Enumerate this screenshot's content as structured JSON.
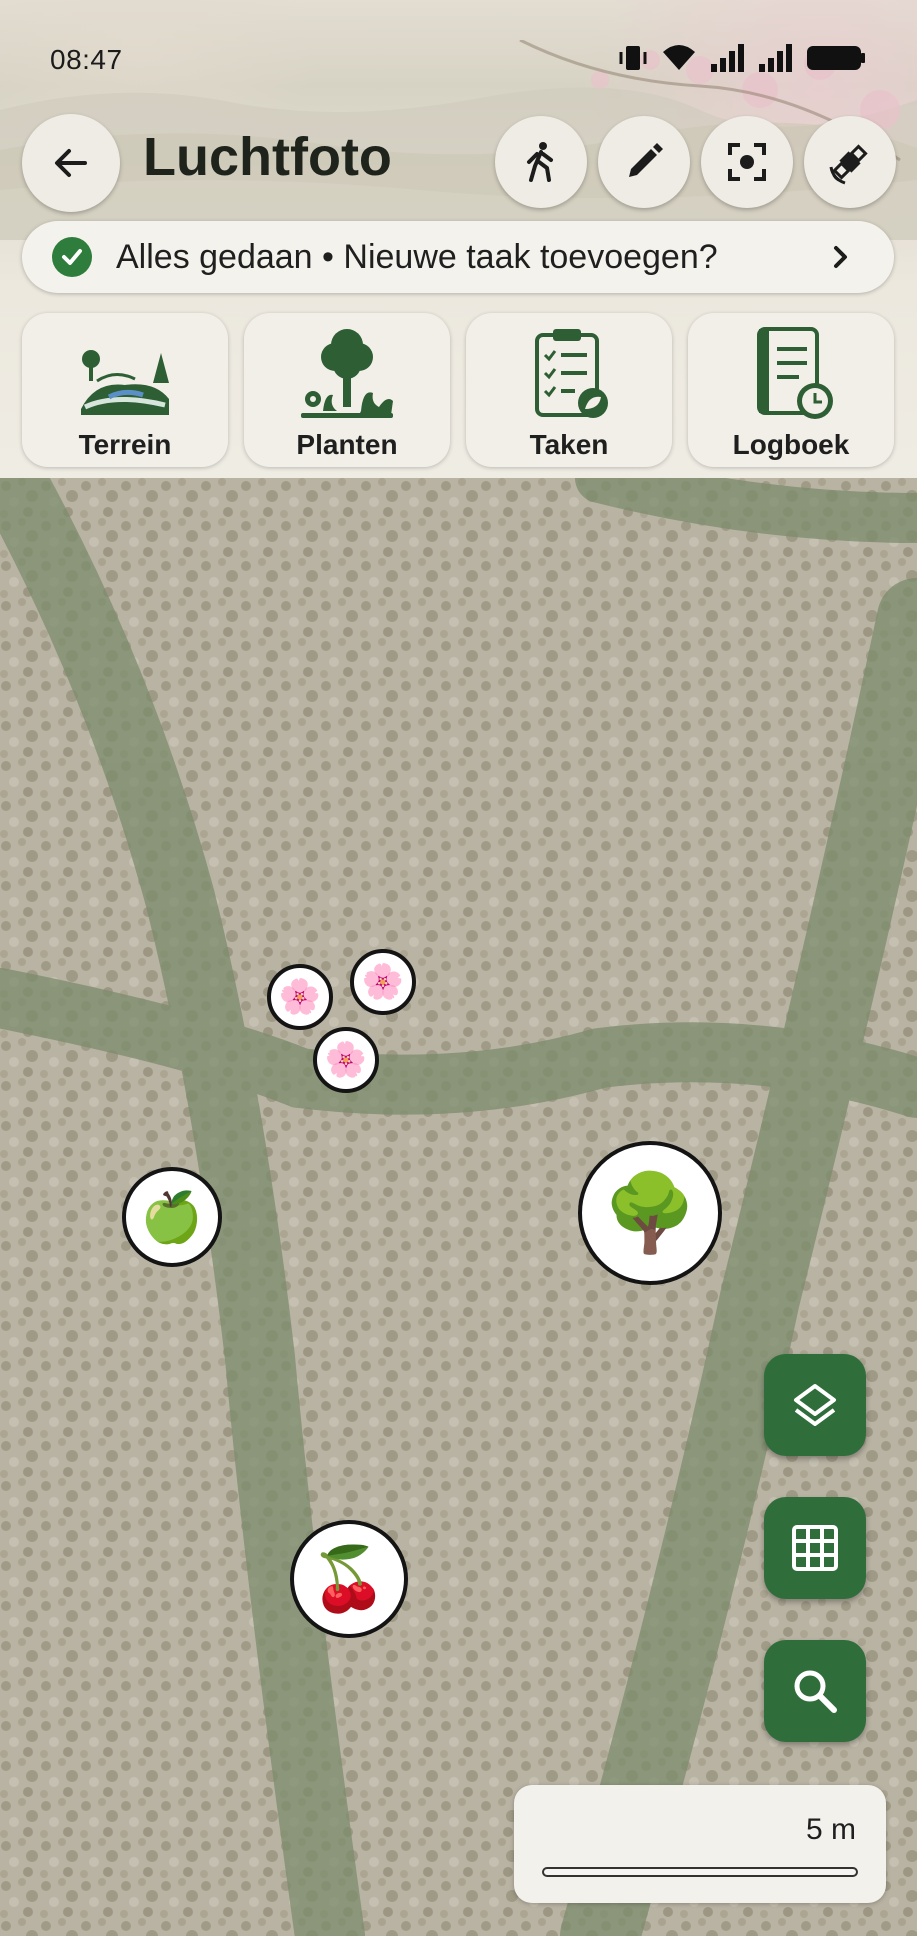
{
  "status_bar": {
    "time": "08:47",
    "icons": [
      "vibrate-icon",
      "wifi-icon",
      "signal-icon",
      "signal-icon",
      "battery-icon"
    ]
  },
  "header": {
    "title": "Luchtfoto",
    "back_icon": "arrow-left-icon",
    "actions": [
      "walk-icon",
      "pencil-icon",
      "center-focus-icon",
      "satellite-icon"
    ]
  },
  "banner": {
    "text": "Alles gedaan • Nieuwe taak toevoegen?",
    "icon": "check-circle-icon",
    "chevron": "chevron-right-icon"
  },
  "tiles": [
    {
      "label": "Terrein",
      "icon": "terrain-icon"
    },
    {
      "label": "Planten",
      "icon": "plants-icon"
    },
    {
      "label": "Taken",
      "icon": "tasks-icon"
    },
    {
      "label": "Logboek",
      "icon": "logbook-icon"
    }
  ],
  "map": {
    "markers": [
      {
        "emoji": "🌸",
        "name": "blossom"
      },
      {
        "emoji": "🌸",
        "name": "blossom"
      },
      {
        "emoji": "🌸",
        "name": "blossom"
      },
      {
        "emoji": "🍏",
        "name": "apple"
      },
      {
        "emoji": "🌳",
        "name": "tree"
      },
      {
        "emoji": "🍒",
        "name": "cherry"
      }
    ],
    "controls": [
      "layers-icon",
      "grid-icon",
      "search-icon"
    ],
    "scale_label": "5 m"
  },
  "colors": {
    "accent_green": "#2f6d3b",
    "check_green": "#2e7d3c",
    "panel": "#f1efe8"
  }
}
